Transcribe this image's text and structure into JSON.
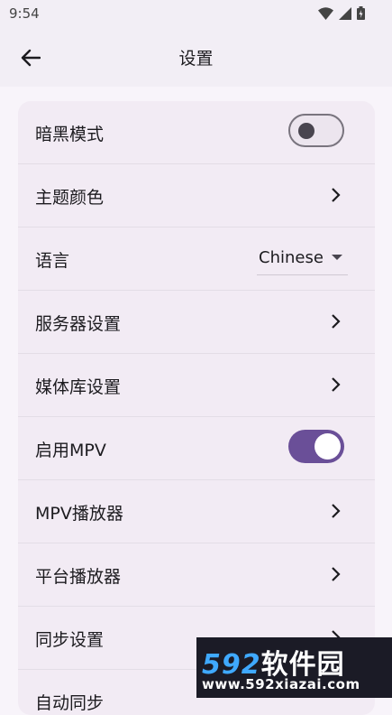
{
  "status_bar": {
    "time": "9:54",
    "icons": [
      "wifi-icon",
      "signal-icon",
      "battery-icon"
    ]
  },
  "app_bar": {
    "back_icon": "arrow-left-icon",
    "title": "设置"
  },
  "settings": {
    "dark_mode": {
      "label": "暗黑模式",
      "enabled": false
    },
    "theme_color": {
      "label": "主题颜色"
    },
    "language": {
      "label": "语言",
      "value": "Chinese"
    },
    "server_settings": {
      "label": "服务器设置"
    },
    "media_library": {
      "label": "媒体库设置"
    },
    "enable_mpv": {
      "label": "启用MPV",
      "enabled": true
    },
    "mpv_player": {
      "label": "MPV播放器"
    },
    "platform_player": {
      "label": "平台播放器"
    },
    "sync_settings": {
      "label": "同步设置"
    },
    "auto_sync": {
      "label": "自动同步"
    }
  },
  "watermark": {
    "logo_digits": "592",
    "logo_text": "软件园",
    "url": "www.592xiazai.com"
  },
  "colors": {
    "accent": "#6a4f98",
    "background": "#f8f4fa",
    "card": "#f2ebf4"
  }
}
